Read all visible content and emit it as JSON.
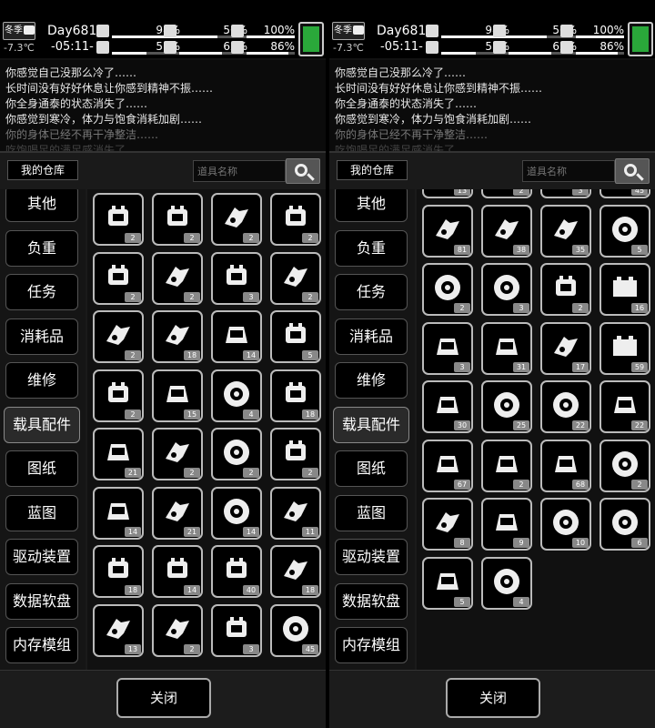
{
  "status": {
    "season": "冬季",
    "temperature": "-7.3℃",
    "day": "Day681",
    "time": "-05:11-",
    "stats": [
      {
        "name": "health",
        "icon": "medkit-icon",
        "value": "98%",
        "level": 0.98
      },
      {
        "name": "hunger",
        "icon": "stomach-icon",
        "value": "56%",
        "level": 0.56
      },
      {
        "name": "mood",
        "icon": "heart-icon",
        "value": "100%",
        "level": 1.0
      },
      {
        "name": "energy",
        "icon": "bed-icon",
        "value": "51%",
        "level": 0.51
      },
      {
        "name": "thirst",
        "icon": "water-drop-icon",
        "value": "62%",
        "level": 0.62
      },
      {
        "name": "sanity",
        "icon": "heart-icon",
        "value": "86%",
        "level": 0.86
      }
    ],
    "battery_level": 1.0
  },
  "messages": [
    "你感觉自己没那么冷了……",
    "长时间没有好好休息让你感到精神不振……",
    "你全身通泰的状态消失了……",
    "你感觉到寒冷，体力与饱食消耗加剧……",
    "你的身体已经不再干净整洁……",
    "吃饱喝足的满足感消失了……"
  ],
  "warehouse": {
    "title": "我的仓库",
    "search_placeholder": "道具名称",
    "categories": [
      "其他",
      "负重",
      "任务",
      "消耗品",
      "维修",
      "载具配件",
      "图纸",
      "蓝图",
      "驱动装置",
      "数据软盘",
      "内存模组"
    ],
    "selected_category": "载具配件",
    "close_label": "关闭"
  },
  "left_items": [
    {
      "icon": "starter-motor-icon",
      "count": "2"
    },
    {
      "icon": "alternator-icon",
      "count": "2"
    },
    {
      "icon": "fuel-pump-icon",
      "count": "2"
    },
    {
      "icon": "engine-block-icon",
      "count": "2"
    },
    {
      "icon": "v8-engine-icon",
      "count": "2"
    },
    {
      "icon": "shock-absorber-icon",
      "count": "2"
    },
    {
      "icon": "piston-icon",
      "count": "3"
    },
    {
      "icon": "spoiler-icon",
      "count": "2"
    },
    {
      "icon": "fender-icon",
      "count": "2"
    },
    {
      "icon": "exhaust-icon",
      "count": "18"
    },
    {
      "icon": "car-body-icon",
      "count": "14"
    },
    {
      "icon": "gearbox-icon",
      "count": "5"
    },
    {
      "icon": "motor-icon",
      "count": "2"
    },
    {
      "icon": "windshield-icon",
      "count": "15"
    },
    {
      "icon": "wheel-icon",
      "count": "4"
    },
    {
      "icon": "engine-icon",
      "count": "18"
    },
    {
      "icon": "roof-box-icon",
      "count": "21"
    },
    {
      "icon": "drive-shaft-icon",
      "count": "2"
    },
    {
      "icon": "tire-icon",
      "count": "2"
    },
    {
      "icon": "turbo-icon",
      "count": "2"
    },
    {
      "icon": "axle-frame-icon",
      "count": "14"
    },
    {
      "icon": "suspension-icon",
      "count": "21"
    },
    {
      "icon": "tire-icon",
      "count": "14"
    },
    {
      "icon": "ram-plow-icon",
      "count": "11"
    },
    {
      "icon": "v-engine-icon",
      "count": "18"
    },
    {
      "icon": "motor-icon",
      "count": "14"
    },
    {
      "icon": "engine-icon",
      "count": "40"
    },
    {
      "icon": "axle-icon",
      "count": "18"
    },
    {
      "icon": "crane-arm-icon",
      "count": "13"
    },
    {
      "icon": "trailer-icon",
      "count": "2"
    },
    {
      "icon": "engine-block-icon",
      "count": "3"
    },
    {
      "icon": "offroad-tire-icon",
      "count": "45"
    }
  ],
  "right_items": [
    {
      "icon": "crane-arm-icon",
      "count": "13"
    },
    {
      "icon": "trailer-icon",
      "count": "2"
    },
    {
      "icon": "engine-block-icon",
      "count": "3"
    },
    {
      "icon": "offroad-tire-icon",
      "count": "45"
    },
    {
      "icon": "spike-plow-icon",
      "count": "81"
    },
    {
      "icon": "shock-absorber-icon",
      "count": "38"
    },
    {
      "icon": "blade-icon",
      "count": "35"
    },
    {
      "icon": "tire-icon",
      "count": "5"
    },
    {
      "icon": "offroad-tire-icon",
      "count": "2"
    },
    {
      "icon": "wheel-icon",
      "count": "3"
    },
    {
      "icon": "motor-icon",
      "count": "2"
    },
    {
      "icon": "battery-icon",
      "count": "16"
    },
    {
      "icon": "seat-icon",
      "count": "3"
    },
    {
      "icon": "frame-icon",
      "count": "31"
    },
    {
      "icon": "lamp-icon",
      "count": "17"
    },
    {
      "icon": "battery-icon",
      "count": "59"
    },
    {
      "icon": "fuel-tank-icon",
      "count": "30"
    },
    {
      "icon": "rim-icon",
      "count": "25"
    },
    {
      "icon": "hubcap-icon",
      "count": "22"
    },
    {
      "icon": "bike-frame-icon",
      "count": "22"
    },
    {
      "icon": "canopy-icon",
      "count": "67"
    },
    {
      "icon": "cart-frame-icon",
      "count": "2"
    },
    {
      "icon": "saddle-bag-icon",
      "count": "68"
    },
    {
      "icon": "rim-icon",
      "count": "2"
    },
    {
      "icon": "armor-plate-icon",
      "count": "8"
    },
    {
      "icon": "chair-icon",
      "count": "9"
    },
    {
      "icon": "spoked-wheel-icon",
      "count": "10"
    },
    {
      "icon": "spoked-wheel-icon",
      "count": "6"
    },
    {
      "icon": "cage-icon",
      "count": "5"
    },
    {
      "icon": "bicycle-wheel-icon",
      "count": "4"
    }
  ]
}
